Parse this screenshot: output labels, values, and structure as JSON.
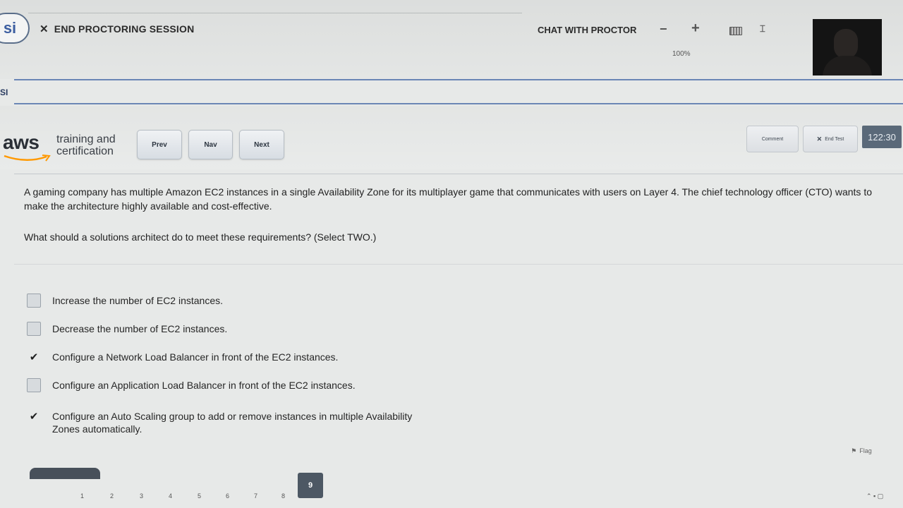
{
  "proctor_bar": {
    "logo": "si",
    "end_session_label": "END PROCTORING SESSION",
    "chat_label": "CHAT WITH PROCTOR",
    "zoom_minus": "−",
    "zoom_plus": "+",
    "zoom_level": "100%",
    "icons": [
      "close-icon",
      "minus-icon",
      "plus-icon",
      "keyboard-icon",
      "calculator-icon",
      "webcam-feed"
    ]
  },
  "subbar": {
    "label": "SI"
  },
  "exam_header": {
    "aws_word": "aws",
    "tagline_line1": "training and",
    "tagline_line2": "certification",
    "prev_label": "Prev",
    "nav_label": "Nav",
    "next_label": "Next",
    "comment_label": "Comment",
    "end_test_label": "End Test",
    "timer": "122:30",
    "brand_color": "#ff9900"
  },
  "question": {
    "text": "A gaming company has multiple Amazon EC2 instances in a single Availability Zone for its multiplayer game that communicates with users on Layer 4. The chief technology officer (CTO) wants to make the architecture highly available and cost-effective.",
    "prompt": "What should a solutions architect do to meet these requirements? (Select TWO.)",
    "options": [
      {
        "label": "Increase the number of EC2 instances.",
        "checked": false
      },
      {
        "label": "Decrease the number of EC2 instances.",
        "checked": false
      },
      {
        "label": "Configure a Network Load Balancer in front of the EC2 instances.",
        "checked": true
      },
      {
        "label": "Configure an Application Load Balancer in front of the EC2 instances.",
        "checked": false
      },
      {
        "label": "Configure an Auto Scaling group to add or remove instances in multiple Availability Zones automatically.",
        "checked": true
      }
    ],
    "checkmark": "✔"
  },
  "flag_label": "Flag",
  "pagination": {
    "pages": [
      "1",
      "2",
      "3",
      "4",
      "5",
      "6",
      "7",
      "8"
    ],
    "current": "9"
  }
}
